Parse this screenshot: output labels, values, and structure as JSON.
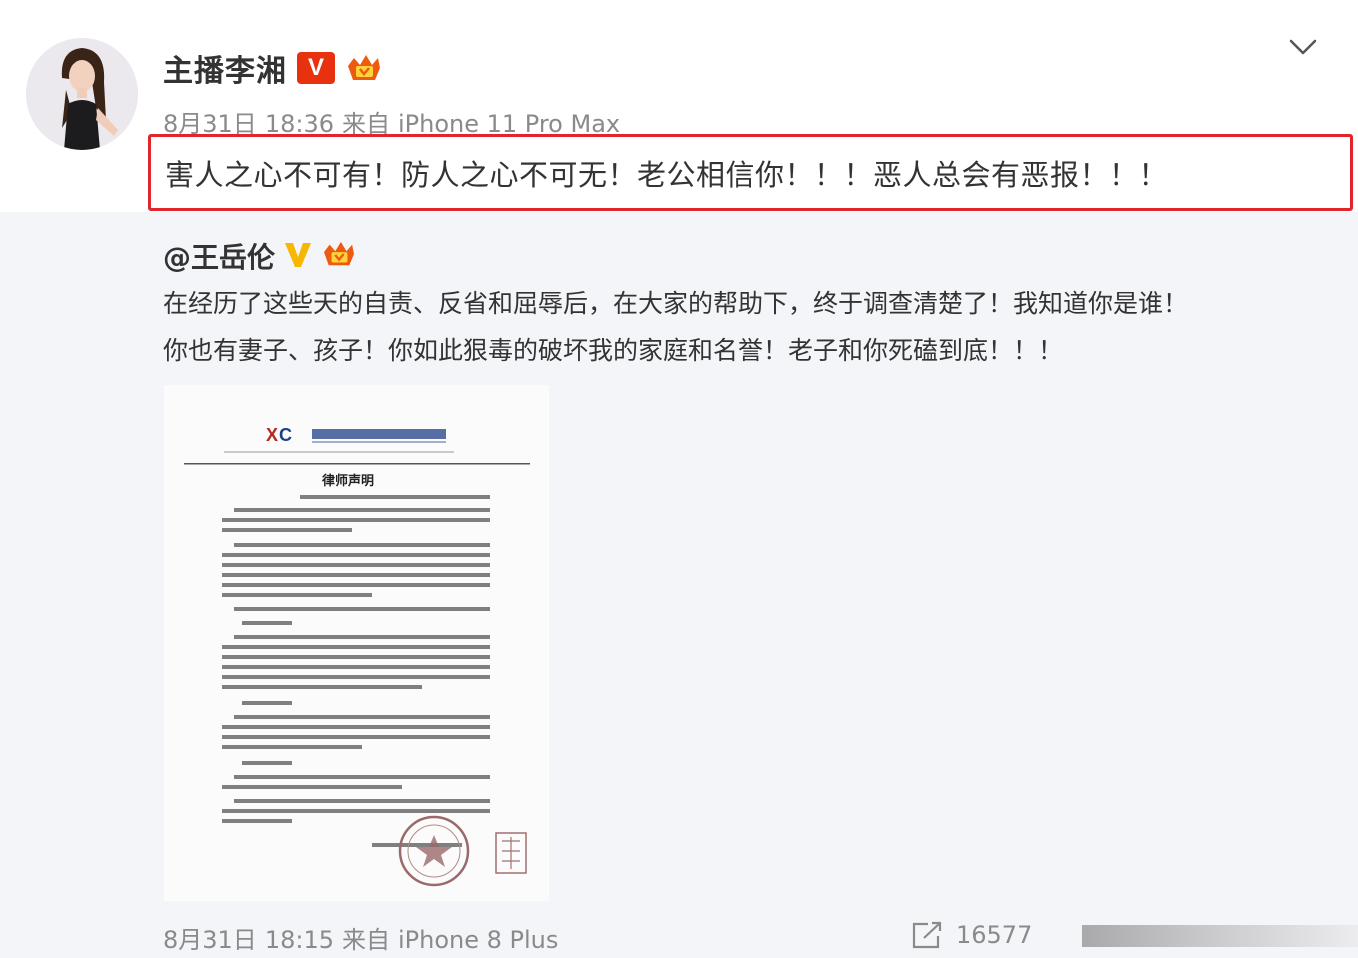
{
  "post": {
    "author": "主播李湘",
    "verified_badge": "V",
    "date": "8月31日",
    "time": "18:36",
    "source_prefix": "来自",
    "source_device": "iPhone 11 Pro Max",
    "text": "害人之心不可有！防人之心不可无！老公相信你！！！恶人总会有恶报！！！"
  },
  "repost": {
    "author": "@王岳伦",
    "verified_badge": "V",
    "lines": [
      "在经历了这些天的自责、反省和屈辱后，在大家的帮助下，终于调查清楚了！我知道你是谁！",
      "你也有妻子、孩子！你如此狠毒的破坏我的家庭和名誉！老子和你死磕到底！！！"
    ],
    "image_title": "律师声明",
    "date": "8月31日",
    "time": "18:15",
    "source_prefix": "来自",
    "source_device": "iPhone 8 Plus",
    "share_count": "16577"
  },
  "colors": {
    "highlight_border": "#e0262b",
    "verified_red": "#e8320f",
    "verified_gold": "#f5b700",
    "meta_gray": "#8a8a8a",
    "repost_bg": "#f4f5f8"
  },
  "icons": {
    "chevron": "chevron-down-icon",
    "share": "share-icon",
    "vip": "vip-crown-icon"
  }
}
